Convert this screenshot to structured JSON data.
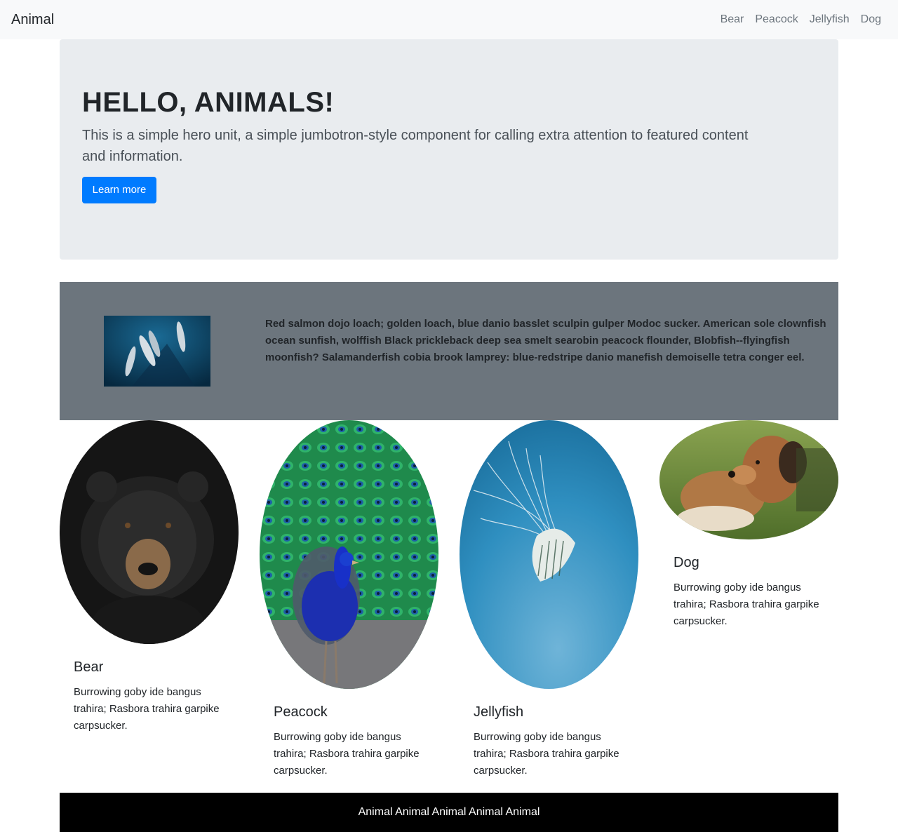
{
  "navbar": {
    "brand": "Animal",
    "links": [
      "Bear",
      "Peacock",
      "Jellyfish",
      "Dog"
    ]
  },
  "hero": {
    "title": "HELLO, ANIMALS!",
    "lead": "This is a simple hero unit, a simple jumbotron-style component for calling extra attention to featured content and information.",
    "button_label": "Learn more"
  },
  "feature": {
    "image": "dolphins-photo",
    "text": "Red salmon dojo loach; golden loach, blue danio basslet sculpin gulper Modoc sucker. American sole clownfish ocean sunfish, wolffish Black prickleback deep sea smelt searobin peacock flounder, Blobfish--flyingfish moonfish? Salamanderfish cobia brook lamprey: blue-redstripe danio manefish demoiselle tetra conger eel."
  },
  "cards": [
    {
      "title": "Bear",
      "text": "Burrowing goby ide bangus trahira; Rasbora trahira garpike carpsucker.",
      "image": "bear-photo"
    },
    {
      "title": "Peacock",
      "text": "Burrowing goby ide bangus trahira; Rasbora trahira garpike carpsucker.",
      "image": "peacock-photo"
    },
    {
      "title": "Jellyfish",
      "text": "Burrowing goby ide bangus trahira; Rasbora trahira garpike carpsucker.",
      "image": "jellyfish-photo"
    },
    {
      "title": "Dog",
      "text": "Burrowing goby ide bangus trahira; Rasbora trahira garpike carpsucker.",
      "image": "dog-photo"
    }
  ],
  "footer": {
    "text": "Animal Animal Animal Animal Animal"
  }
}
